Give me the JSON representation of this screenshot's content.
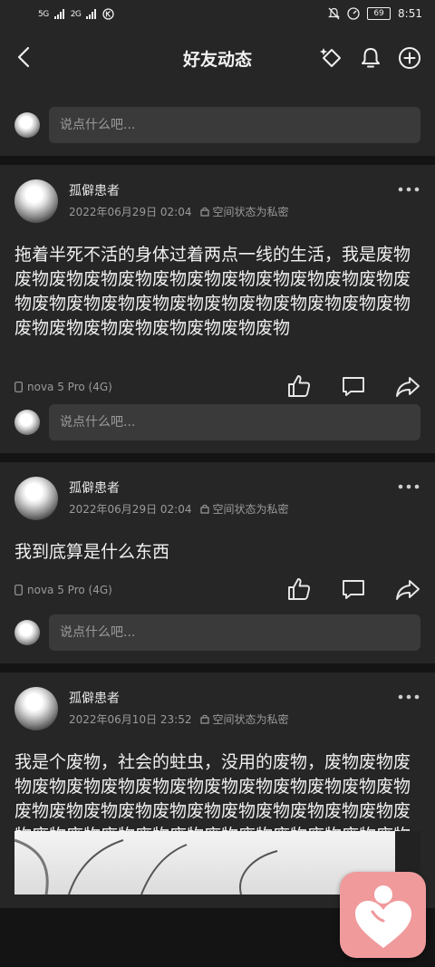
{
  "status_bar": {
    "signal_1": "5G",
    "signal_2": "2G",
    "battery": "69",
    "time": "8:51"
  },
  "nav": {
    "title": "好友动态"
  },
  "comment_placeholder": "说点什么吧...",
  "posts": [
    {
      "author": "孤僻患者",
      "date": "2022年06月29日 02:04",
      "privacy": "空间状态为私密",
      "text": "拖着半死不活的身体过着两点一线的生活，我是废物废物废物废物废物废物废物废物废物废物废物废物废物废物废物废物废物废物废物废物废物废物废物废物废物废物废物废物废物废物废物废物",
      "device": "nova 5 Pro (4G)"
    },
    {
      "author": "孤僻患者",
      "date": "2022年06月29日 02:04",
      "privacy": "空间状态为私密",
      "text": "我到底算是什么东西",
      "device": "nova 5 Pro (4G)"
    },
    {
      "author": "孤僻患者",
      "date": "2022年06月10日 23:52",
      "privacy": "空间状态为私密",
      "text": "我是个废物，社会的蛀虫，没用的废物，废物废物废物废物废物废物废物废物废物废物废物废物废物废物废物废物废物废物废物废物废物废物废物废物废物废物废物废物废物废物废物废物废物废物废物废物废物废物废物废物废物废物废物废物废物废物废物废物废物废物废物废物废物废物"
    }
  ]
}
